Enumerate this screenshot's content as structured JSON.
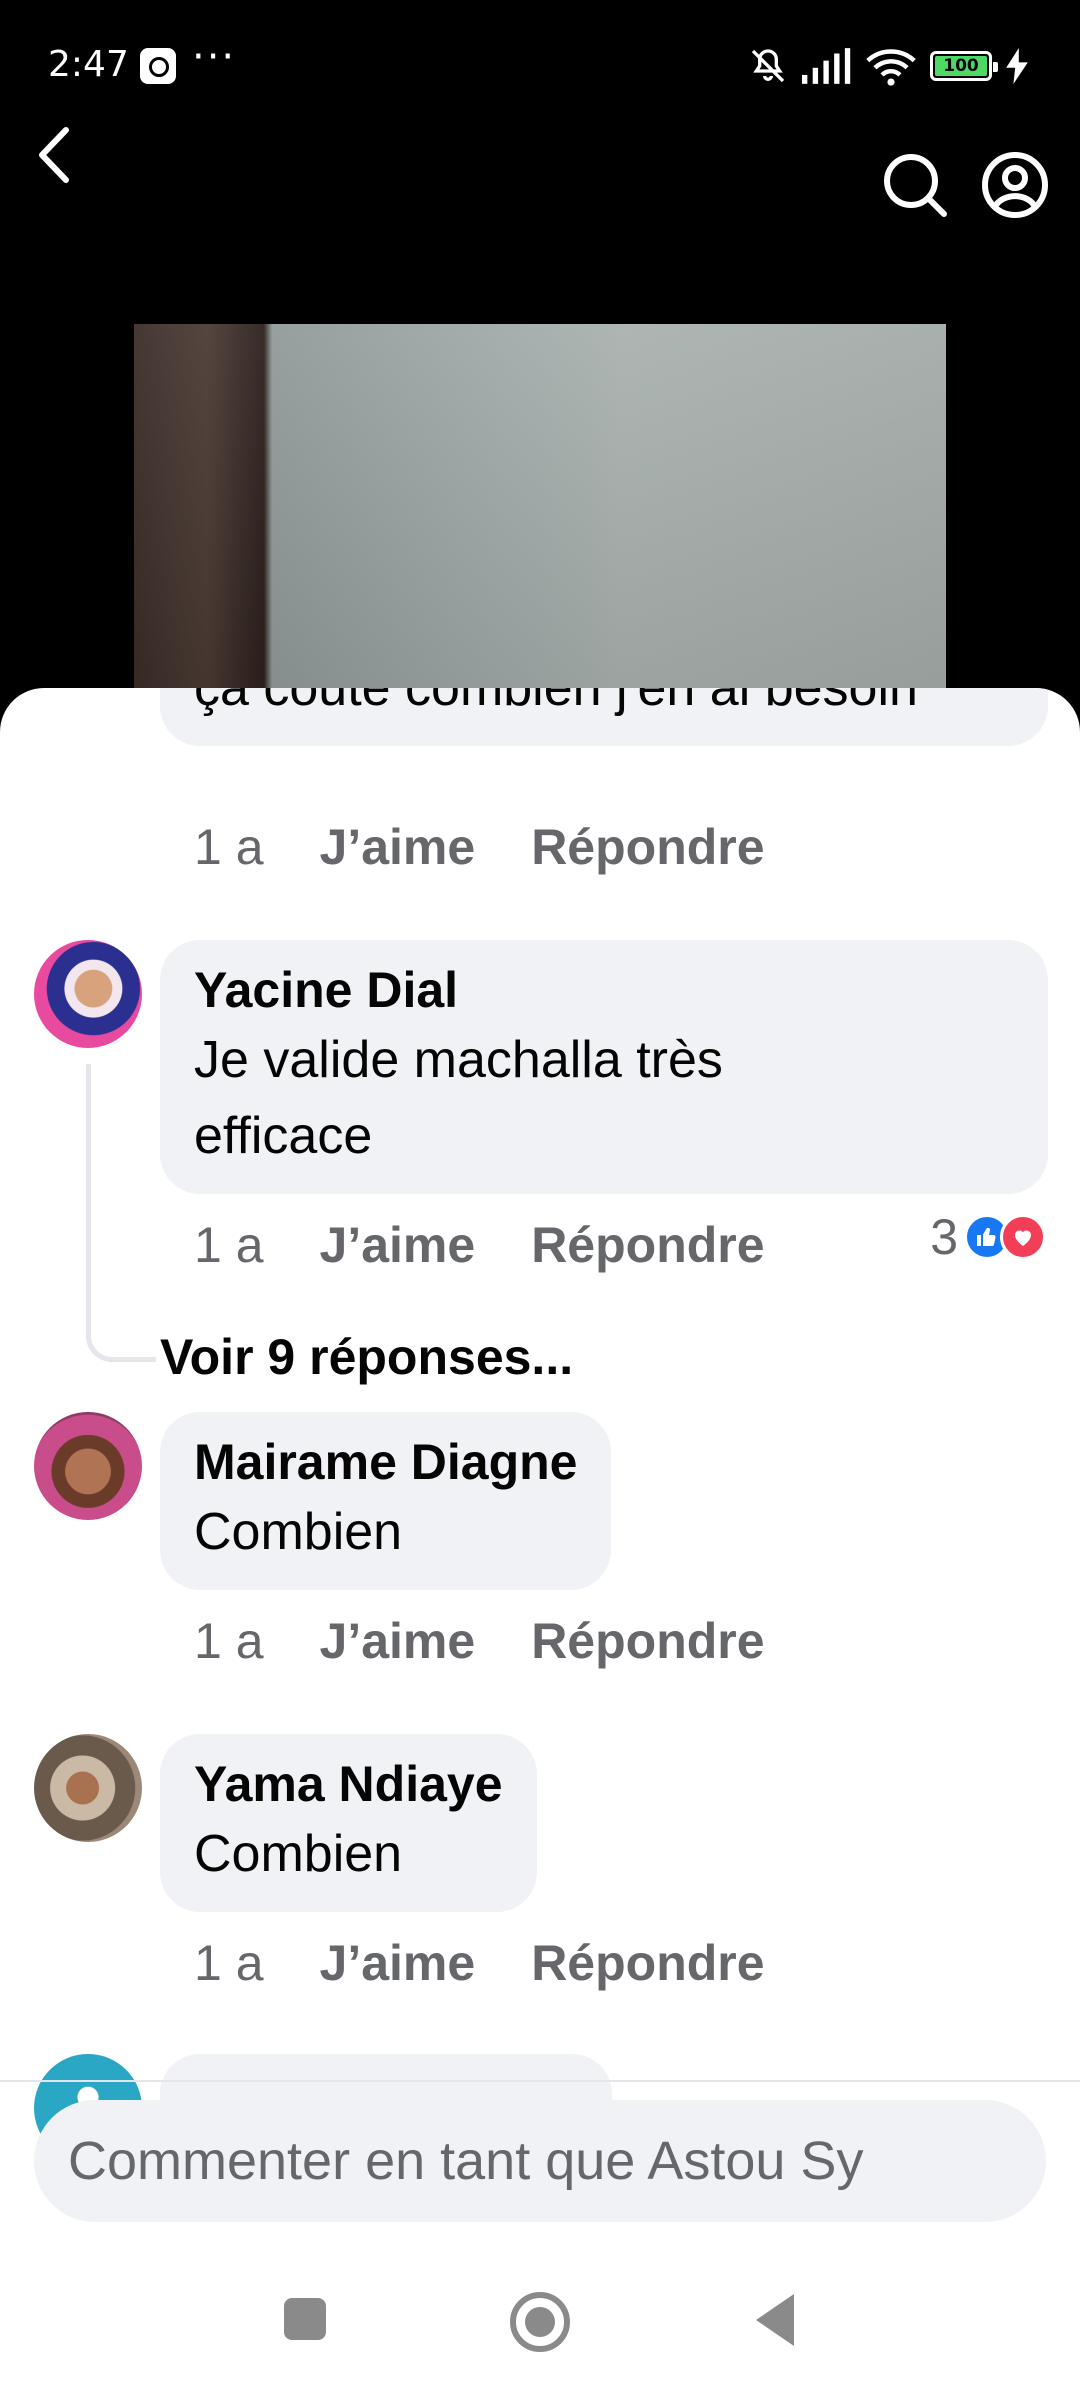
{
  "status_bar": {
    "time": "2:47",
    "more": "···",
    "battery": "100"
  },
  "comments": [
    {
      "text": "ça coute combien j'en ai besoin",
      "age": "1 a",
      "like": "J’aime",
      "reply": "Répondre"
    },
    {
      "author": "Yacine Dial",
      "text": "Je valide machalla très efficace",
      "age": "1 a",
      "like": "J’aime",
      "reply": "Répondre",
      "reaction_count": "3",
      "view_replies": "Voir 9 réponses..."
    },
    {
      "author": "Mairame Diagne",
      "text": "Combien",
      "age": "1 a",
      "like": "J’aime",
      "reply": "Répondre"
    },
    {
      "author": "Yama Ndiaye",
      "text": "Combien",
      "age": "1 a",
      "like": "J’aime",
      "reply": "Répondre"
    }
  ],
  "composer": {
    "placeholder": "Commenter en tant que Astou Sy"
  },
  "colors": {
    "like_blue": "#1877f2",
    "love_red": "#f33e58",
    "bubble_bg": "#f0f2f5",
    "meta_grey": "#65676b"
  },
  "icons": [
    "back-chevron-icon",
    "search-icon",
    "profile-icon",
    "like-reaction-icon",
    "love-reaction-icon",
    "mute-bell-icon",
    "signal-icon",
    "wifi-icon",
    "battery-icon",
    "charging-icon"
  ]
}
